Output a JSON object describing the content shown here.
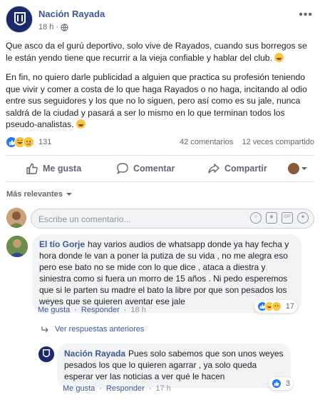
{
  "post": {
    "page_name": "Nación Rayada",
    "time": "18 h",
    "paragraph_1": "Que asco da el gurú deportivo, solo vive de Rayados, cuando sus borregos se le están yendo tiene que recurrir a la vieja confiable y hablar del club.",
    "paragraph_2": "En fin, no quiero darle publicidad a alguien que practica su profesión teniendo que vivir y comer a costa de lo que haga Rayados o no haga, incitando al odio entre sus seguidores y los que no lo siguen, pero así como es su jale, nunca saldrá de la ciudad y pasará a ser lo mismo en lo que terminan todos los pseudo-analistas.",
    "reaction_count": "131",
    "comments_count": "42 comentarios",
    "shares_count": "12 veces compartido"
  },
  "actions": {
    "like": "Me gusta",
    "comment": "Comentar",
    "share": "Compartir"
  },
  "sort_label": "Más relevantes",
  "comment_input": {
    "placeholder": "Escribe un comentario..."
  },
  "comments": [
    {
      "author": "El tío Gorje",
      "text": "hay varios audios de whatsapp donde ya hay fecha y hora donde le van a poner la putiza de su vida , no me alegra eso pero ese bato no se mide con lo que dice , ataca a diestra y siniestra como si fuera un morro de 15 años . Ni pedo esperemos que si le parten su madre el bato la libre por que son pesados los weyes que se quieren aventar ese jale",
      "like_label": "Me gusta",
      "reply_label": "Responder",
      "time": "18 h",
      "reaction_count": "17"
    }
  ],
  "previous_replies": "Ver respuestas anteriores",
  "reply": {
    "author": "Nación Rayada",
    "text": "Pues solo sabemos que son unos weyes pesados los que lo quieren agarrar , ya solo queda esperar ver las noticias a ver qué le hacen",
    "like_label": "Me gusta",
    "reply_label": "Responder",
    "time": "17 h",
    "reaction_count": "3"
  },
  "colors": {
    "link": "#385898",
    "like_blue": "#2078f4",
    "muted": "#606770"
  }
}
